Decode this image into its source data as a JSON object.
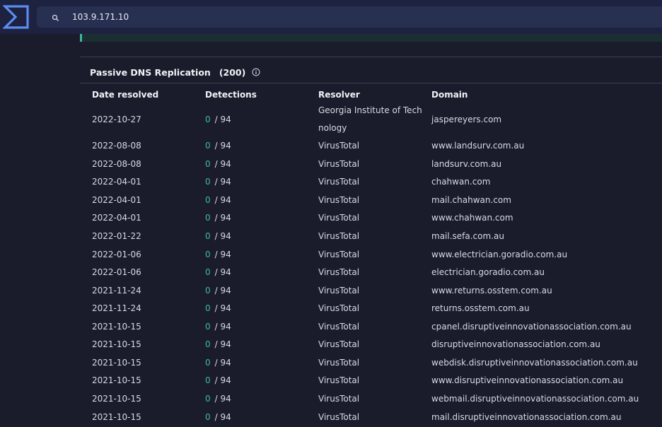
{
  "search": {
    "value": "103.9.171.10"
  },
  "panel": {
    "title": "Passive DNS Replication",
    "count": "(200)"
  },
  "table": {
    "columns": [
      "Date resolved",
      "Detections",
      "Resolver",
      "Domain"
    ],
    "rows": [
      {
        "date": "2022-10-27",
        "det": "0",
        "total": "/ 94",
        "resolver": "Georgia Institute of Technology",
        "domain": "jaspereyers.com"
      },
      {
        "date": "2022-08-08",
        "det": "0",
        "total": "/ 94",
        "resolver": "VirusTotal",
        "domain": "www.landsurv.com.au"
      },
      {
        "date": "2022-08-08",
        "det": "0",
        "total": "/ 94",
        "resolver": "VirusTotal",
        "domain": "landsurv.com.au"
      },
      {
        "date": "2022-04-01",
        "det": "0",
        "total": "/ 94",
        "resolver": "VirusTotal",
        "domain": "chahwan.com"
      },
      {
        "date": "2022-04-01",
        "det": "0",
        "total": "/ 94",
        "resolver": "VirusTotal",
        "domain": "mail.chahwan.com"
      },
      {
        "date": "2022-04-01",
        "det": "0",
        "total": "/ 94",
        "resolver": "VirusTotal",
        "domain": "www.chahwan.com"
      },
      {
        "date": "2022-01-22",
        "det": "0",
        "total": "/ 94",
        "resolver": "VirusTotal",
        "domain": "mail.sefa.com.au"
      },
      {
        "date": "2022-01-06",
        "det": "0",
        "total": "/ 94",
        "resolver": "VirusTotal",
        "domain": "www.electrician.goradio.com.au"
      },
      {
        "date": "2022-01-06",
        "det": "0",
        "total": "/ 94",
        "resolver": "VirusTotal",
        "domain": "electrician.goradio.com.au"
      },
      {
        "date": "2021-11-24",
        "det": "0",
        "total": "/ 94",
        "resolver": "VirusTotal",
        "domain": "www.returns.osstem.com.au"
      },
      {
        "date": "2021-11-24",
        "det": "0",
        "total": "/ 94",
        "resolver": "VirusTotal",
        "domain": "returns.osstem.com.au"
      },
      {
        "date": "2021-10-15",
        "det": "0",
        "total": "/ 94",
        "resolver": "VirusTotal",
        "domain": "cpanel.disruptiveinnovationassociation.com.au"
      },
      {
        "date": "2021-10-15",
        "det": "0",
        "total": "/ 94",
        "resolver": "VirusTotal",
        "domain": "disruptiveinnovationassociation.com.au"
      },
      {
        "date": "2021-10-15",
        "det": "0",
        "total": "/ 94",
        "resolver": "VirusTotal",
        "domain": "webdisk.disruptiveinnovationassociation.com.au"
      },
      {
        "date": "2021-10-15",
        "det": "0",
        "total": "/ 94",
        "resolver": "VirusTotal",
        "domain": "www.disruptiveinnovationassociation.com.au"
      },
      {
        "date": "2021-10-15",
        "det": "0",
        "total": "/ 94",
        "resolver": "VirusTotal",
        "domain": "webmail.disruptiveinnovationassociation.com.au"
      },
      {
        "date": "2021-10-15",
        "det": "0",
        "total": "/ 94",
        "resolver": "VirusTotal",
        "domain": "mail.disruptiveinnovationassociation.com.au"
      }
    ]
  },
  "icons": {
    "logo": "virustotal-logo",
    "search": "search-icon",
    "info": "info-icon"
  },
  "colors": {
    "accent": "#3fb8a1",
    "logo": "#5b8def"
  }
}
